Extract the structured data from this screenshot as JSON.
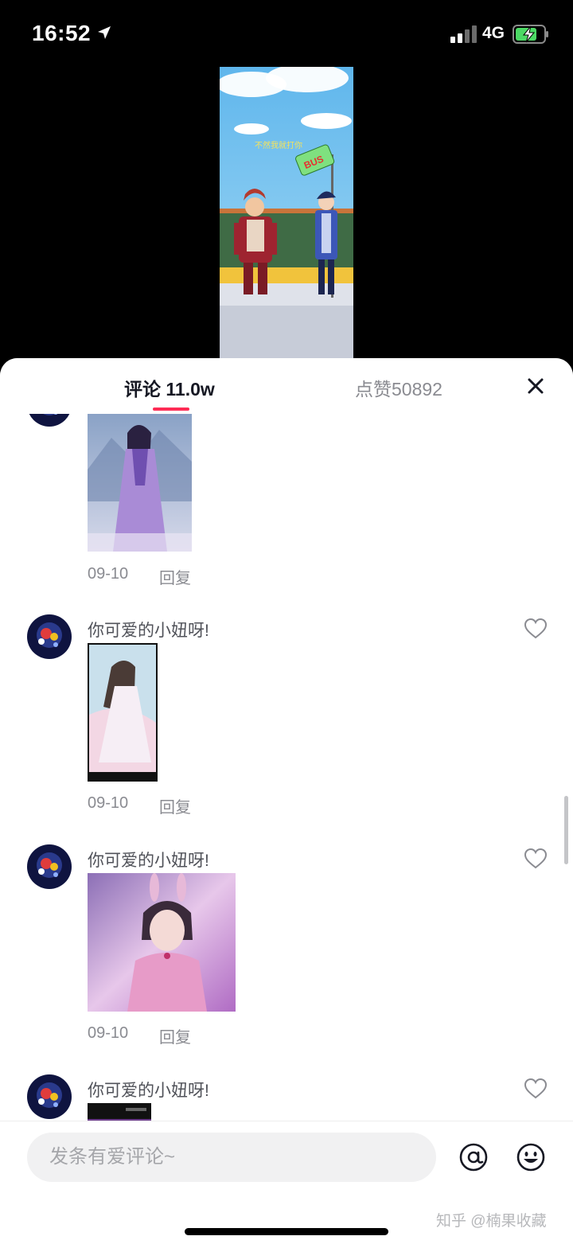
{
  "status_bar": {
    "time": "16:52",
    "network": "4G"
  },
  "tabs": {
    "comments_label": "评论",
    "comments_count": "11.0w",
    "likes_label": "点赞50892"
  },
  "comments": [
    {
      "text": "",
      "date": "09-10",
      "reply": "回复"
    },
    {
      "text": "你可爱的小妞呀!",
      "date": "09-10",
      "reply": "回复"
    },
    {
      "text": "你可爱的小妞呀!",
      "date": "09-10",
      "reply": "回复"
    },
    {
      "text": "你可爱的小妞呀!"
    }
  ],
  "input": {
    "placeholder": "发条有爱评论~"
  },
  "watermark": "知乎 @楠果收藏",
  "video": {
    "caption": "不然我就打你",
    "sign_text": "BUS"
  },
  "colors": {
    "accent": "#fe2c55",
    "text_primary": "#161823",
    "text_secondary": "#8a8b91"
  },
  "icons": [
    "location-arrow-icon",
    "signal-icon",
    "battery-charging-icon",
    "close-icon",
    "heart-icon",
    "at-icon",
    "emoji-icon"
  ]
}
